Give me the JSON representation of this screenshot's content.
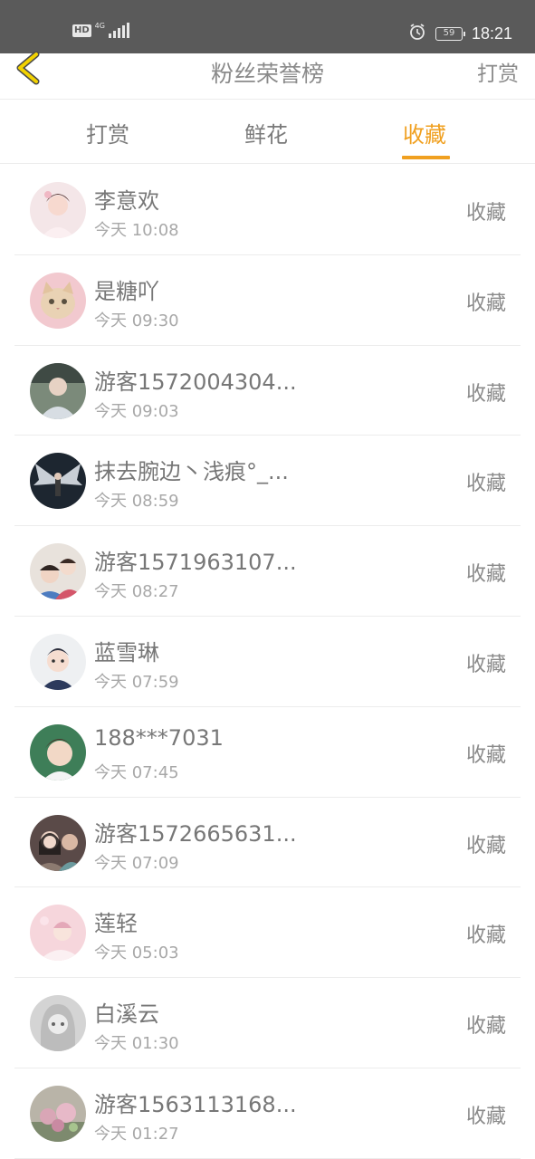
{
  "status_bar": {
    "hd_label": "HD",
    "network_label": "4G",
    "battery_level": "59",
    "time": "18:21",
    "icons": [
      "signal-icon",
      "alarm-icon",
      "battery-icon"
    ]
  },
  "nav": {
    "title": "粉丝荣誉榜",
    "action_label": "打赏",
    "back_icon": "chevron-left-icon",
    "back_color": "#f2d200"
  },
  "tabs": {
    "items": [
      {
        "label": "打赏",
        "active": false
      },
      {
        "label": "鲜花",
        "active": false
      },
      {
        "label": "收藏",
        "active": true
      }
    ],
    "accent_color": "#f0a020"
  },
  "list": {
    "items": [
      {
        "name": "李意欢",
        "time": "今天 10:08",
        "action": "收藏"
      },
      {
        "name": "是糖吖",
        "time": "今天 09:30",
        "action": "收藏"
      },
      {
        "name": "游客1572004304...",
        "time": "今天 09:03",
        "action": "收藏"
      },
      {
        "name": "抹去腕边丶浅痕°_...",
        "time": "今天 08:59",
        "action": "收藏"
      },
      {
        "name": "游客1571963107...",
        "time": "今天 08:27",
        "action": "收藏"
      },
      {
        "name": "蓝雪琳",
        "time": "今天 07:59",
        "action": "收藏"
      },
      {
        "name": "188***7031",
        "time": "今天 07:45",
        "action": "收藏"
      },
      {
        "name": "游客1572665631...",
        "time": "今天 07:09",
        "action": "收藏"
      },
      {
        "name": "莲轻",
        "time": "今天 05:03",
        "action": "收藏"
      },
      {
        "name": "白溪云",
        "time": "今天 01:30",
        "action": "收藏"
      },
      {
        "name": "游客1563113168...",
        "time": "今天 01:27",
        "action": "收藏"
      }
    ]
  }
}
